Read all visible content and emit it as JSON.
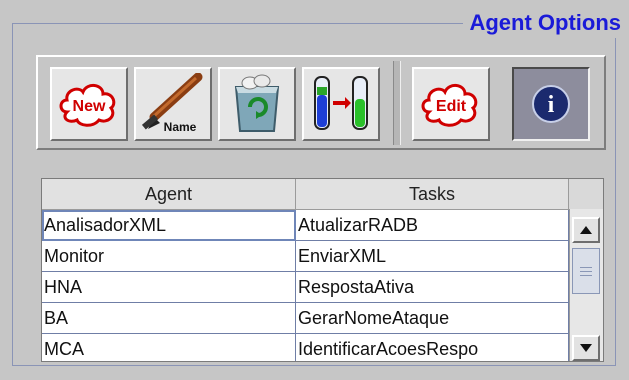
{
  "panel": {
    "title": "Agent Options"
  },
  "toolbar": {
    "buttons": [
      {
        "name": "new-button",
        "label": "New",
        "icon": "new-cloud-icon"
      },
      {
        "name": "rename-button",
        "label": "Name",
        "icon": "pen-rename-icon"
      },
      {
        "name": "delete-button",
        "label": "",
        "icon": "recycle-bin-icon"
      },
      {
        "name": "transfer-button",
        "label": "",
        "icon": "test-tubes-transfer-icon"
      },
      {
        "name": "edit-button",
        "label": "Edit",
        "icon": "edit-cloud-icon"
      },
      {
        "name": "info-button",
        "label": "i",
        "icon": "info-icon"
      }
    ]
  },
  "table": {
    "columns": [
      "Agent",
      "Tasks"
    ],
    "rows": [
      [
        "AnalisadorXML",
        "AtualizarRADB"
      ],
      [
        "Monitor",
        "EnviarXML"
      ],
      [
        "HNA",
        "RespostaAtiva"
      ],
      [
        "BA",
        "GerarNomeAtaque"
      ],
      [
        "MCA",
        "IdentificarAcoesRespo"
      ]
    ]
  },
  "colors": {
    "title": "#1a1ad8",
    "background": "#c6c6c6",
    "selection_border": "#6f86b8"
  }
}
